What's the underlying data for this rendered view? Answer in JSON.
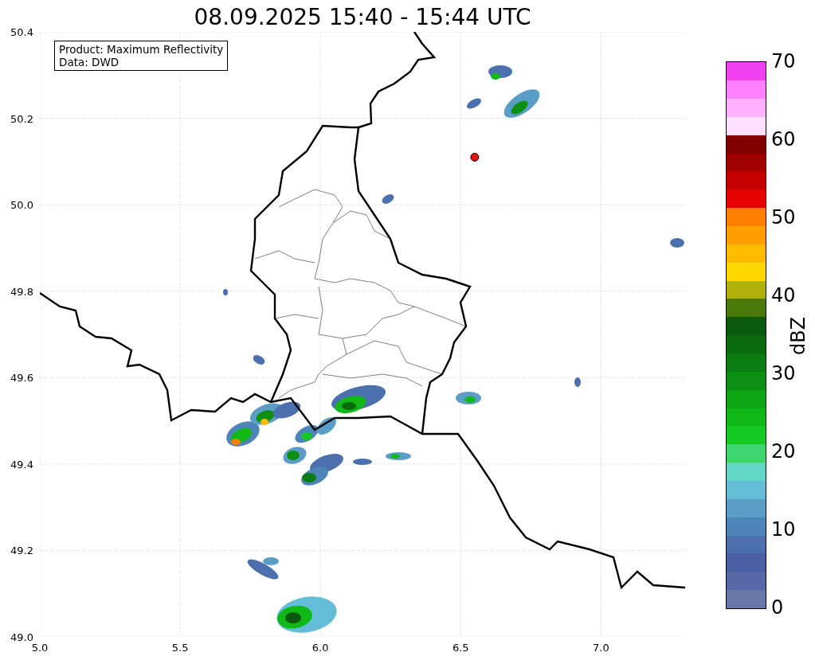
{
  "title": "08.09.2025 15:40 - 15:44 UTC",
  "legend": {
    "lines": [
      "Product: Maximum Reflectivity",
      "Data: DWD"
    ]
  },
  "x_axis": {
    "ticks": [
      "5.0",
      "5.5",
      "6.0",
      "6.5",
      "7.0"
    ]
  },
  "y_axis": {
    "ticks": [
      "50.4",
      "50.2",
      "50.0",
      "49.8",
      "49.6",
      "49.4",
      "49.2",
      "49.0"
    ]
  },
  "colorbar": {
    "label": "dBZ",
    "ticks": [
      "70",
      "60",
      "50",
      "40",
      "30",
      "20",
      "10",
      "0"
    ],
    "segments": [
      {
        "color": "#6677a8"
      },
      {
        "color": "#5668a6"
      },
      {
        "color": "#4a5ea3"
      },
      {
        "color": "#4b70ad"
      },
      {
        "color": "#4e85b8"
      },
      {
        "color": "#5a9ec7"
      },
      {
        "color": "#63bdd6"
      },
      {
        "color": "#62d6c6"
      },
      {
        "color": "#3dd66e"
      },
      {
        "color": "#16c922"
      },
      {
        "color": "#10b818"
      },
      {
        "color": "#0ea514"
      },
      {
        "color": "#0c8f12"
      },
      {
        "color": "#0b7c10"
      },
      {
        "color": "#0a6a0e"
      },
      {
        "color": "#0a590c"
      },
      {
        "color": "#4a7a0a"
      },
      {
        "color": "#b0b00a"
      },
      {
        "color": "#ffd800"
      },
      {
        "color": "#ffbb00"
      },
      {
        "color": "#ff9e00"
      },
      {
        "color": "#ff7f00"
      },
      {
        "color": "#e60000"
      },
      {
        "color": "#c40000"
      },
      {
        "color": "#a00000"
      },
      {
        "color": "#800000"
      },
      {
        "color": "#ffe0ff"
      },
      {
        "color": "#ffb0ff"
      },
      {
        "color": "#ff80ff"
      },
      {
        "color": "#f040f0"
      }
    ]
  }
}
